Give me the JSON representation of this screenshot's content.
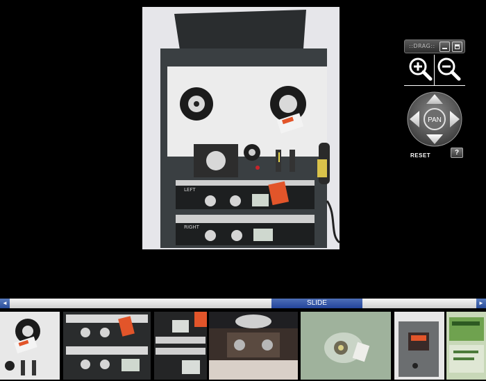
{
  "zoom_panel": {
    "drag_label": "::DRAG::",
    "pan_label": "PAN",
    "reset_label": "RESET",
    "help_label": "?"
  },
  "slider": {
    "label": "SLIDE",
    "prev_arrow": "◄",
    "next_arrow": "►"
  },
  "photo": {
    "panel_left_label": "LEFT",
    "panel_right_label": "RIGHT"
  },
  "icons": {
    "zoom_in": "zoom-in-icon",
    "zoom_out": "zoom-out-icon",
    "pan_up": "arrow-up-icon",
    "pan_down": "arrow-down-icon",
    "pan_left": "arrow-left-icon",
    "pan_right": "arrow-right-icon"
  },
  "colors": {
    "background": "#000000",
    "slider_blue": "#2a4d99",
    "control_gray": "#6b6b6b",
    "deck_face": "#e8e8e8",
    "deck_case": "#3c4144",
    "tag_orange": "#e2552a"
  }
}
